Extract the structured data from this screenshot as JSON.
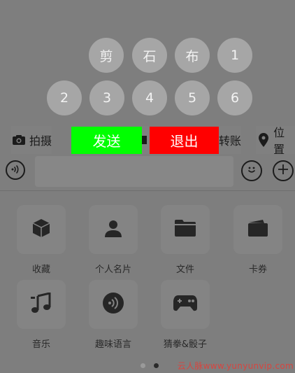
{
  "keypad": {
    "row1": [
      "剪",
      "石",
      "布",
      "1"
    ],
    "row2": [
      "2",
      "3",
      "4",
      "5",
      "6"
    ]
  },
  "toolbar": {
    "photo_label": "拍摄",
    "transfer_label": "转账",
    "location_label": "位置"
  },
  "overlay_buttons": {
    "send_label": "发送",
    "send_color": "#00ff00",
    "exit_label": "退出",
    "exit_color": "#ff0000"
  },
  "input": {
    "value": "",
    "placeholder": ""
  },
  "panel": {
    "items": [
      {
        "label": "收藏",
        "icon": "cube-icon"
      },
      {
        "label": "个人名片",
        "icon": "person-icon"
      },
      {
        "label": "文件",
        "icon": "folder-icon"
      },
      {
        "label": "卡券",
        "icon": "wallet-icon"
      },
      {
        "label": "音乐",
        "icon": "music-note-icon"
      },
      {
        "label": "趣味语言",
        "icon": "voice-icon"
      },
      {
        "label": "猜拳&骰子",
        "icon": "gamepad-icon"
      }
    ],
    "page_count": 2,
    "current_page": 2
  },
  "watermark": "云人脉www.yunyunvip.com"
}
